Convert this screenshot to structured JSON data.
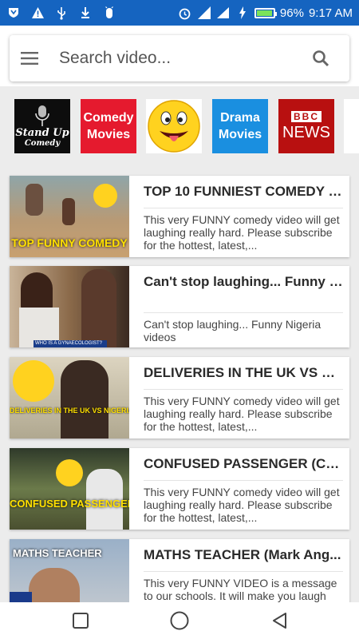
{
  "status_bar": {
    "battery_percent": "96%",
    "battery_level": 0.96,
    "time": "9:17 AM"
  },
  "search": {
    "placeholder": "Search video..."
  },
  "categories": [
    {
      "name": "standup",
      "line1": "Stand Up",
      "line2": "Comedy"
    },
    {
      "name": "comedy",
      "line1": "Comedy",
      "line2": "Movies"
    },
    {
      "name": "emoji",
      "icon": "laughing-face-icon"
    },
    {
      "name": "drama",
      "line1": "Drama",
      "line2": "Movies"
    },
    {
      "name": "bbc",
      "line1": "BBC",
      "line2": "NEWS"
    }
  ],
  "videos": [
    {
      "title": "TOP 10 FUNNIEST COMEDY S...",
      "description": "This very FUNNY comedy video will get laughing really hard. Please subscribe for the hottest, latest,...",
      "thumb_caption": "TOP FUNNY COMEDY"
    },
    {
      "title": "Can't stop laughing... Funny N...",
      "description": "Can't stop laughing... Funny Nigeria videos",
      "thumb_caption": "WHO IS A GYNAECOLOGIST?"
    },
    {
      "title": "DELIVERIES IN THE UK VS NI...",
      "description": "This very FUNNY comedy video will get laughing really hard. Please subscribe for the hottest, latest,...",
      "thumb_caption": "DELIVERIES IN THE UK VS NIGERIA"
    },
    {
      "title": "CONFUSED PASSENGER (CO...",
      "description": "This very FUNNY comedy video will get laughing really hard. Please subscribe for the hottest, latest,...",
      "thumb_caption": "CONFUSED PASSENGER"
    },
    {
      "title": "MATHS TEACHER (Mark Ang...",
      "description": "This very FUNNY VIDEO is a message to our schools. It will make you laugh",
      "thumb_caption": "MATHS TEACHER"
    }
  ],
  "colors": {
    "status_bar": "#1564c0",
    "list_background": "#ececec"
  }
}
